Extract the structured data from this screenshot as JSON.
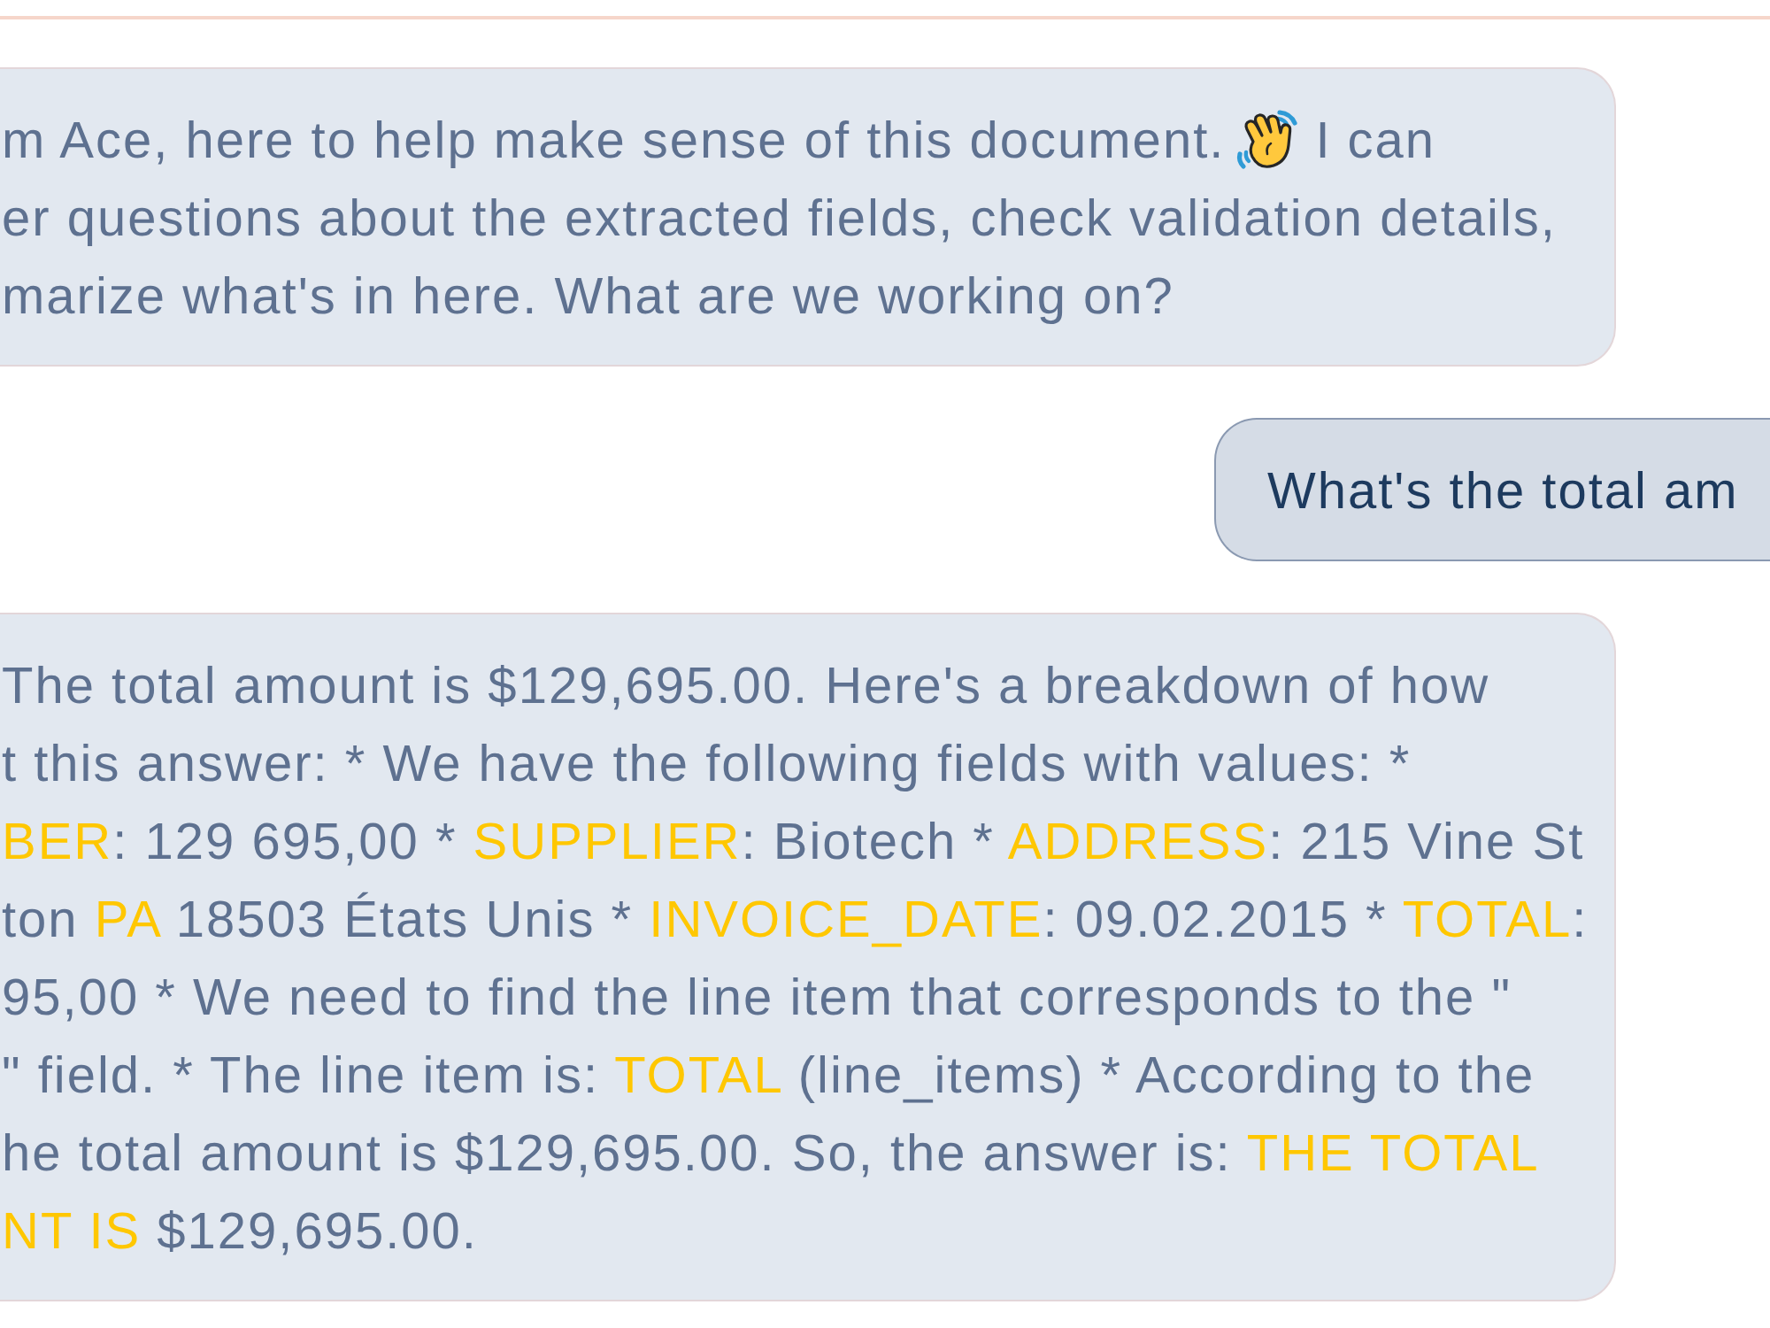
{
  "messages": [
    {
      "kind": "assistant",
      "lines": [
        [
          {
            "kind": "text",
            "text": "m Ace, here to help make sense of this document.",
            "highlighted": false
          },
          {
            "kind": "emoji"
          },
          {
            "kind": "text",
            "text": "I can",
            "highlighted": false
          }
        ],
        [
          {
            "kind": "text",
            "text": "er questions about the extracted fields, check validation details,",
            "highlighted": false
          }
        ],
        [
          {
            "kind": "text",
            "text": "marize what's in here. What are we working on?",
            "highlighted": false
          }
        ]
      ]
    },
    {
      "kind": "user",
      "lines": [
        [
          {
            "kind": "text",
            "text": "What's the total am",
            "highlighted": false
          }
        ]
      ]
    },
    {
      "kind": "assistant",
      "lines": [
        [
          {
            "kind": "text",
            "text": "The total amount is $129,695.00. Here's a breakdown of how",
            "highlighted": false
          }
        ],
        [
          {
            "kind": "text",
            "text": "t this answer: * We have the following fields with values: *",
            "highlighted": false
          }
        ],
        [
          {
            "kind": "text",
            "text": "BER",
            "highlighted": true
          },
          {
            "kind": "text",
            "text": ": 129 695,00 * ",
            "highlighted": false
          },
          {
            "kind": "text",
            "text": "SUPPLIER",
            "highlighted": true
          },
          {
            "kind": "text",
            "text": ": Biotech * ",
            "highlighted": false
          },
          {
            "kind": "text",
            "text": "ADDRESS",
            "highlighted": true
          },
          {
            "kind": "text",
            "text": ": 215 Vine St",
            "highlighted": false
          }
        ],
        [
          {
            "kind": "text",
            "text": "ton ",
            "highlighted": false
          },
          {
            "kind": "text",
            "text": "PA",
            "highlighted": true
          },
          {
            "kind": "text",
            "text": " 18503 États Unis * ",
            "highlighted": false
          },
          {
            "kind": "text",
            "text": "INVOICE_DATE",
            "highlighted": true
          },
          {
            "kind": "text",
            "text": ": 09.02.2015 * ",
            "highlighted": false
          },
          {
            "kind": "text",
            "text": "TOTAL",
            "highlighted": true
          },
          {
            "kind": "text",
            "text": ":",
            "highlighted": false
          }
        ],
        [
          {
            "kind": "text",
            "text": "95,00 * We need to find the line item that corresponds to the \"",
            "highlighted": false
          }
        ],
        [
          {
            "kind": "text",
            "text": "\" field. * The line item is: ",
            "highlighted": false
          },
          {
            "kind": "text",
            "text": "TOTAL",
            "highlighted": true
          },
          {
            "kind": "text",
            "text": " (line_items) * According to the",
            "highlighted": false
          }
        ],
        [
          {
            "kind": "text",
            "text": "he total amount is $129,695.00. So, the answer is: ",
            "highlighted": false
          },
          {
            "kind": "text",
            "text": "THE TOTAL",
            "highlighted": true
          }
        ],
        [
          {
            "kind": "text",
            "text": "NT IS",
            "highlighted": true
          },
          {
            "kind": "text",
            "text": " $129,695.00.",
            "highlighted": false
          }
        ]
      ]
    }
  ]
}
